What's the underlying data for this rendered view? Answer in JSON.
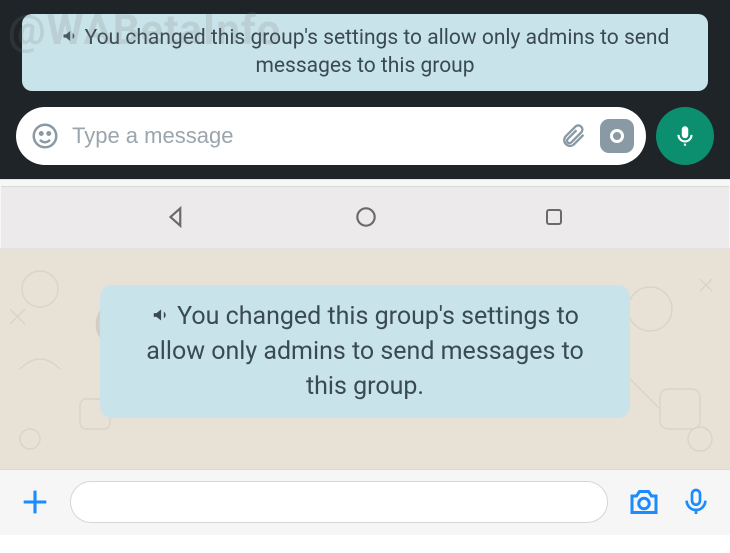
{
  "android": {
    "system_message": "You changed this group's settings to allow only admins to send messages to this group",
    "compose_placeholder": "Type a message"
  },
  "ios": {
    "system_message": "You changed this group's settings to allow only admins to send messages to this group."
  },
  "watermark": "@WABetaInfo"
}
